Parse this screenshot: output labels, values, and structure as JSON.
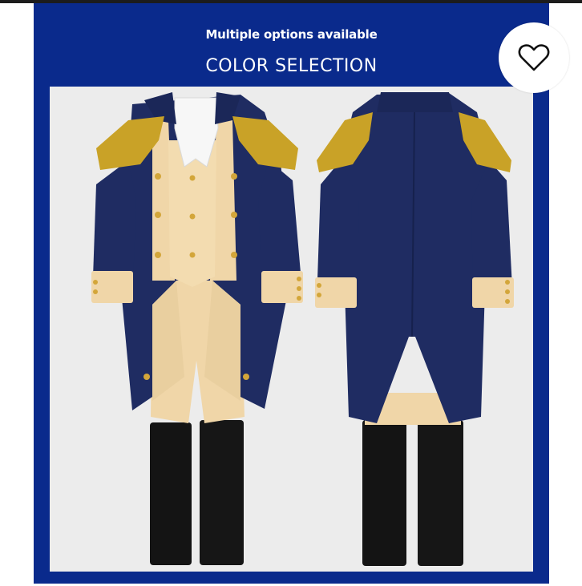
{
  "header": {
    "subtitle": "Multiple options available",
    "title": "COLOR SELECTION"
  },
  "favorite": {
    "icon": "heart-outline-icon"
  },
  "colors": {
    "frame": "#0a2a8c",
    "coat": "#1f2c62",
    "trim": "#f0d6a8",
    "fringe": "#c9a227",
    "boots": "#141414"
  }
}
